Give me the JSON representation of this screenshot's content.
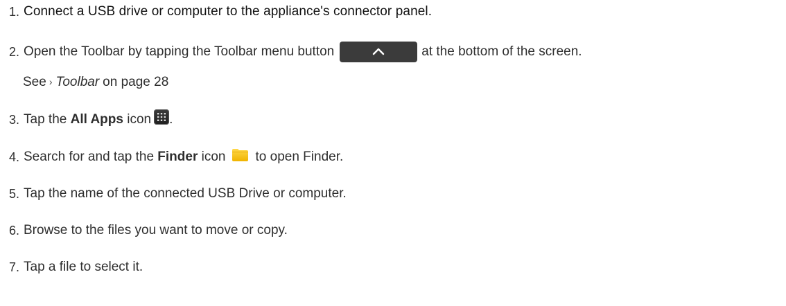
{
  "steps": [
    {
      "number": "1.",
      "parts": [
        "Connect a USB drive or computer to the appliance's connector panel."
      ]
    },
    {
      "number": "2.",
      "parts": [
        "Open the Toolbar by tapping the Toolbar menu button",
        "at the bottom of the screen."
      ],
      "icon": "toolbar-menu-button-icon",
      "see_also": {
        "see": "See",
        "link": "Toolbar",
        "page": "on page 28"
      }
    },
    {
      "number": "3.",
      "parts": [
        "Tap the ",
        "All Apps",
        " icon",
        "."
      ],
      "icon": "all-apps-icon"
    },
    {
      "number": "4.",
      "parts": [
        "Search for and tap the ",
        "Finder",
        " icon",
        "to open Finder."
      ],
      "icon": "finder-folder-icon"
    },
    {
      "number": "5.",
      "parts": [
        "Tap the name of the connected USB Drive or computer."
      ]
    },
    {
      "number": "6.",
      "parts": [
        "Browse to the files you want to move or copy."
      ]
    },
    {
      "number": "7.",
      "parts": [
        "Tap a file to select it."
      ]
    }
  ],
  "colors": {
    "text": "#2e2e2e",
    "toolbar_button": "#3b3b3b",
    "finder_icon": "#f5c518"
  }
}
